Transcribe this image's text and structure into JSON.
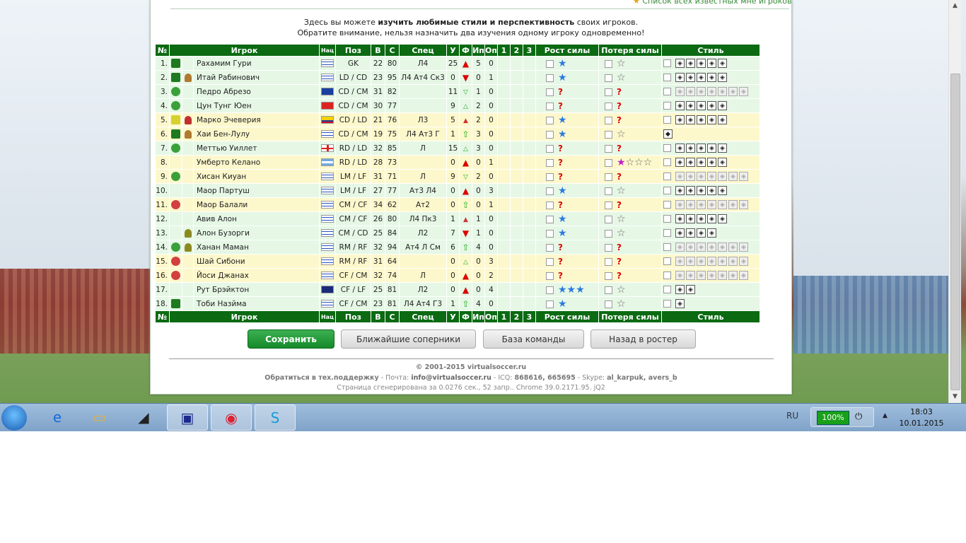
{
  "top_link": "Список всех известных мне игроков",
  "intro": {
    "l1_a": "Здесь вы можете ",
    "l1_b": "изучить любимые стили и перспективность",
    "l1_c": " своих игроков.",
    "l2": "Обратите внимание, нельзя назначить два изучения одному игроку одновременно!"
  },
  "headers": {
    "num": "№",
    "player": "Игрок",
    "nat": "Нац",
    "pos": "Поз",
    "v": "В",
    "s": "С",
    "spec": "Спец",
    "u": "У",
    "f": "Ф",
    "ip": "Ип",
    "op": "Оп",
    "c1": "1",
    "c2": "2",
    "c3": "3",
    "grow": "Рост силы",
    "loss": "Потеря силы",
    "style": "Стиль"
  },
  "players": [
    {
      "n": "1.",
      "name": "Рахамим Гури",
      "flag": "il",
      "pos": "GK",
      "v": "22",
      "s": "80",
      "spec": "Л4",
      "u": "25",
      "f": "up",
      "ip": "5",
      "op": "0",
      "grow": "sb",
      "loss": "sw",
      "row": "g",
      "ic": "dice",
      "p": "",
      "style": "fffff"
    },
    {
      "n": "2.",
      "name": "Итай Рабинович",
      "flag": "il",
      "pos": "LD / CD",
      "v": "23",
      "s": "95",
      "spec": "Л4 Ат4 Ск3",
      "u": "0",
      "f": "down",
      "ip": "0",
      "op": "1",
      "grow": "sb",
      "loss": "sw",
      "row": "g",
      "ic": "dice",
      "p": "pb",
      "style": "fffff"
    },
    {
      "n": "3.",
      "name": "Педро Абрезо",
      "flag": "bz",
      "pos": "CD / CM",
      "v": "31",
      "s": "82",
      "spec": "",
      "u": "11",
      "f": "sdn",
      "ip": "1",
      "op": "0",
      "grow": "q",
      "loss": "q",
      "row": "g",
      "ic": "ball",
      "p": "",
      "style": "ooooooo"
    },
    {
      "n": "4.",
      "name": "Цун Тунг Юен",
      "flag": "hk",
      "pos": "CD / CM",
      "v": "30",
      "s": "77",
      "spec": "",
      "u": "9",
      "f": "supg",
      "ip": "2",
      "op": "0",
      "grow": "q",
      "loss": "q",
      "row": "g",
      "ic": "ball",
      "p": "",
      "style": "fffff"
    },
    {
      "n": "5.",
      "name": "Марко Эчеверия",
      "flag": "co",
      "pos": "CD / LD",
      "v": "21",
      "s": "76",
      "spec": "Л3",
      "u": "5",
      "f": "sup",
      "ip": "2",
      "op": "0",
      "grow": "sb",
      "loss": "q",
      "row": "y",
      "ic": "dicey",
      "p": "pr",
      "style": "fffff"
    },
    {
      "n": "6.",
      "name": "Хаи Бен-Лулу",
      "flag": "il",
      "pos": "CD / CM",
      "v": "19",
      "s": "75",
      "spec": "Л4 Ат3 Г",
      "u": "1",
      "f": "upg",
      "ip": "3",
      "op": "0",
      "grow": "sb",
      "loss": "sw",
      "row": "y",
      "ic": "dice",
      "p": "pb",
      "style": "s"
    },
    {
      "n": "7.",
      "name": "Меттью Уиллет",
      "flag": "en",
      "pos": "RD / LD",
      "v": "32",
      "s": "85",
      "spec": "Л",
      "u": "15",
      "f": "supg",
      "ip": "3",
      "op": "0",
      "grow": "q",
      "loss": "q",
      "row": "g",
      "ic": "ball",
      "p": "",
      "style": "fffff"
    },
    {
      "n": "8.",
      "name": "Умберто Келано",
      "flag": "ar",
      "pos": "RD / LD",
      "v": "28",
      "s": "73",
      "spec": "",
      "u": "0",
      "f": "up",
      "ip": "0",
      "op": "1",
      "grow": "q",
      "loss": "sp",
      "row": "y",
      "ic": "",
      "p": "",
      "style": "fffff"
    },
    {
      "n": "9.",
      "name": "Хисан Киуан",
      "flag": "il",
      "pos": "LM / LF",
      "v": "31",
      "s": "71",
      "spec": "Л",
      "u": "9",
      "f": "sdn",
      "ip": "2",
      "op": "0",
      "grow": "q",
      "loss": "q",
      "row": "y",
      "ic": "ball",
      "p": "",
      "style": "ooooooo"
    },
    {
      "n": "10.",
      "name": "Маор Партуш",
      "flag": "il",
      "pos": "LM / LF",
      "v": "27",
      "s": "77",
      "spec": "Ат3 Л4",
      "u": "0",
      "f": "up",
      "ip": "0",
      "op": "3",
      "grow": "sb",
      "loss": "sw",
      "row": "g",
      "ic": "",
      "p": "",
      "style": "fffff"
    },
    {
      "n": "11.",
      "name": "Маор Балали",
      "flag": "il",
      "pos": "CM / CF",
      "v": "34",
      "s": "62",
      "spec": "Ат2",
      "u": "0",
      "f": "upg",
      "ip": "0",
      "op": "1",
      "grow": "q",
      "loss": "q",
      "row": "y",
      "ic": "ballr",
      "p": "",
      "style": "ooooooo"
    },
    {
      "n": "12.",
      "name": "Авив Алон",
      "flag": "il",
      "pos": "CM / CF",
      "v": "26",
      "s": "80",
      "spec": "Л4 Пк3",
      "u": "1",
      "f": "sup",
      "ip": "1",
      "op": "0",
      "grow": "sb",
      "loss": "sw",
      "row": "g",
      "ic": "",
      "p": "",
      "style": "fffff"
    },
    {
      "n": "13.",
      "name": "Алон Бузорги",
      "flag": "il",
      "pos": "CM / CD",
      "v": "25",
      "s": "84",
      "spec": "Л2",
      "u": "7",
      "f": "down",
      "ip": "1",
      "op": "0",
      "grow": "sb",
      "loss": "sw",
      "row": "g",
      "ic": "",
      "p": "pg",
      "style": "ffff"
    },
    {
      "n": "14.",
      "name": "Ханан Маман",
      "flag": "il",
      "pos": "RM / RF",
      "v": "32",
      "s": "94",
      "spec": "Ат4 Л См",
      "u": "6",
      "f": "upg",
      "ip": "4",
      "op": "0",
      "grow": "q",
      "loss": "q",
      "row": "g",
      "ic": "ball",
      "p": "pg",
      "style": "ooooooo"
    },
    {
      "n": "15.",
      "name": "Шай Сибони",
      "flag": "il",
      "pos": "RM / RF",
      "v": "31",
      "s": "64",
      "spec": "",
      "u": "0",
      "f": "supg",
      "ip": "0",
      "op": "3",
      "grow": "q",
      "loss": "q",
      "row": "y",
      "ic": "ballr",
      "p": "",
      "style": "ooooooo"
    },
    {
      "n": "16.",
      "name": "Йоси Джанах",
      "flag": "il",
      "pos": "CF / CM",
      "v": "32",
      "s": "74",
      "spec": "Л",
      "u": "0",
      "f": "up",
      "ip": "0",
      "op": "2",
      "grow": "q",
      "loss": "q",
      "row": "y",
      "ic": "ballr",
      "p": "",
      "style": "ooooooo"
    },
    {
      "n": "17.",
      "name": "Рут Брэйктон",
      "flag": "ky",
      "pos": "CF / LF",
      "v": "25",
      "s": "81",
      "spec": "Л2",
      "u": "0",
      "f": "up",
      "ip": "0",
      "op": "4",
      "grow": "sb3",
      "loss": "sw",
      "row": "g",
      "ic": "",
      "p": "",
      "style": "ff"
    },
    {
      "n": "18.",
      "name": "Тоби Назйма",
      "flag": "il",
      "pos": "CF / CM",
      "v": "23",
      "s": "81",
      "spec": "Л4 Ат4 Г3",
      "u": "1",
      "f": "upg",
      "ip": "4",
      "op": "0",
      "grow": "sb",
      "loss": "sw",
      "row": "g",
      "ic": "dice",
      "p": "",
      "style": "f"
    }
  ],
  "buttons": {
    "save": "Сохранить",
    "rivals": "Ближайшие соперники",
    "base": "База команды",
    "back": "Назад в ростер"
  },
  "footer": {
    "copy": "© 2001-2015 virtualsoccer.ru",
    "support_a": "Обратиться в тех.поддержку",
    "support_b": " - Почта: ",
    "mail": "info@virtualsoccer.ru",
    "icq_label": " - ICQ: ",
    "icq": "868616, 665695",
    "skype_label": " - Skype: ",
    "skype": "al_karpuk, avers_b",
    "gen": "Страница сгенерирована за 0.0276 сек., 52 запр.. Chrome 39.0.2171.95. jQ2"
  },
  "taskbar": {
    "lang": "RU",
    "battery": "100%",
    "time": "18:03",
    "date": "10.01.2015"
  }
}
